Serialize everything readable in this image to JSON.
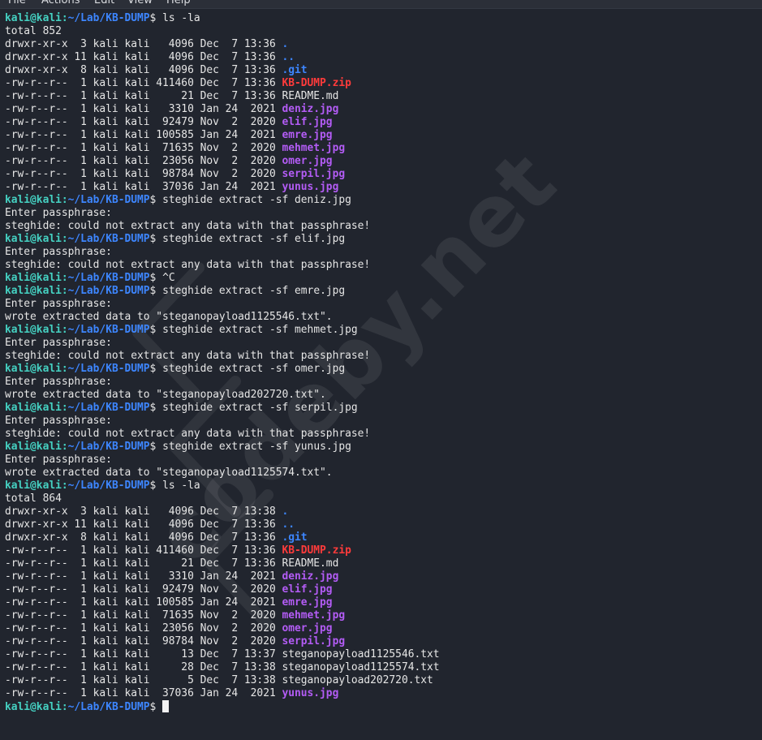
{
  "menu": [
    "File",
    "Actions",
    "Edit",
    "View",
    "Help"
  ],
  "prompt": {
    "user": "kali@kali",
    "path": "~/Lab/KB-DUMP",
    "symbol": "$"
  },
  "watermark": "codeby.net",
  "lines": [
    {
      "type": "prompt",
      "cmd": "ls -la"
    },
    {
      "type": "text",
      "text": "total 852"
    },
    {
      "type": "entry",
      "pre": "drwxr-xr-x  3 kali kali   4096 Dec  7 13:36 ",
      "name": ".",
      "kind": "dir"
    },
    {
      "type": "entry",
      "pre": "drwxr-xr-x 11 kali kali   4096 Dec  7 13:36 ",
      "name": "..",
      "kind": "dir"
    },
    {
      "type": "entry",
      "pre": "drwxr-xr-x  8 kali kali   4096 Dec  7 13:36 ",
      "name": ".git",
      "kind": "dir"
    },
    {
      "type": "entry",
      "pre": "-rw-r--r--  1 kali kali 411460 Dec  7 13:36 ",
      "name": "KB-DUMP.zip",
      "kind": "zip"
    },
    {
      "type": "entry",
      "pre": "-rw-r--r--  1 kali kali     21 Dec  7 13:36 ",
      "name": "README.md",
      "kind": "file"
    },
    {
      "type": "entry",
      "pre": "-rw-r--r--  1 kali kali   3310 Jan 24  2021 ",
      "name": "deniz.jpg",
      "kind": "img"
    },
    {
      "type": "entry",
      "pre": "-rw-r--r--  1 kali kali  92479 Nov  2  2020 ",
      "name": "elif.jpg",
      "kind": "img"
    },
    {
      "type": "entry",
      "pre": "-rw-r--r--  1 kali kali 100585 Jan 24  2021 ",
      "name": "emre.jpg",
      "kind": "img"
    },
    {
      "type": "entry",
      "pre": "-rw-r--r--  1 kali kali  71635 Nov  2  2020 ",
      "name": "mehmet.jpg",
      "kind": "img"
    },
    {
      "type": "entry",
      "pre": "-rw-r--r--  1 kali kali  23056 Nov  2  2020 ",
      "name": "omer.jpg",
      "kind": "img"
    },
    {
      "type": "entry",
      "pre": "-rw-r--r--  1 kali kali  98784 Nov  2  2020 ",
      "name": "serpil.jpg",
      "kind": "img"
    },
    {
      "type": "entry",
      "pre": "-rw-r--r--  1 kali kali  37036 Jan 24  2021 ",
      "name": "yunus.jpg",
      "kind": "img"
    },
    {
      "type": "prompt",
      "cmd": "steghide extract -sf deniz.jpg"
    },
    {
      "type": "text",
      "text": "Enter passphrase:"
    },
    {
      "type": "text",
      "text": "steghide: could not extract any data with that passphrase!"
    },
    {
      "type": "prompt",
      "cmd": "steghide extract -sf elif.jpg"
    },
    {
      "type": "text",
      "text": "Enter passphrase:"
    },
    {
      "type": "text",
      "text": "steghide: could not extract any data with that passphrase!"
    },
    {
      "type": "prompt",
      "cmd": "^C"
    },
    {
      "type": "prompt",
      "cmd": "steghide extract -sf emre.jpg"
    },
    {
      "type": "text",
      "text": "Enter passphrase:"
    },
    {
      "type": "text",
      "text": "wrote extracted data to \"steganopayload1125546.txt\"."
    },
    {
      "type": "prompt",
      "cmd": "steghide extract -sf mehmet.jpg"
    },
    {
      "type": "text",
      "text": "Enter passphrase:"
    },
    {
      "type": "text",
      "text": "steghide: could not extract any data with that passphrase!"
    },
    {
      "type": "prompt",
      "cmd": "steghide extract -sf omer.jpg"
    },
    {
      "type": "text",
      "text": "Enter passphrase:"
    },
    {
      "type": "text",
      "text": "wrote extracted data to \"steganopayload202720.txt\"."
    },
    {
      "type": "prompt",
      "cmd": "steghide extract -sf serpil.jpg"
    },
    {
      "type": "text",
      "text": "Enter passphrase:"
    },
    {
      "type": "text",
      "text": "steghide: could not extract any data with that passphrase!"
    },
    {
      "type": "prompt",
      "cmd": "steghide extract -sf yunus.jpg"
    },
    {
      "type": "text",
      "text": "Enter passphrase:"
    },
    {
      "type": "text",
      "text": "wrote extracted data to \"steganopayload1125574.txt\"."
    },
    {
      "type": "prompt",
      "cmd": "ls -la"
    },
    {
      "type": "text",
      "text": "total 864"
    },
    {
      "type": "entry",
      "pre": "drwxr-xr-x  3 kali kali   4096 Dec  7 13:38 ",
      "name": ".",
      "kind": "dir"
    },
    {
      "type": "entry",
      "pre": "drwxr-xr-x 11 kali kali   4096 Dec  7 13:36 ",
      "name": "..",
      "kind": "dir"
    },
    {
      "type": "entry",
      "pre": "drwxr-xr-x  8 kali kali   4096 Dec  7 13:36 ",
      "name": ".git",
      "kind": "dir"
    },
    {
      "type": "entry",
      "pre": "-rw-r--r--  1 kali kali 411460 Dec  7 13:36 ",
      "name": "KB-DUMP.zip",
      "kind": "zip"
    },
    {
      "type": "entry",
      "pre": "-rw-r--r--  1 kali kali     21 Dec  7 13:36 ",
      "name": "README.md",
      "kind": "file"
    },
    {
      "type": "entry",
      "pre": "-rw-r--r--  1 kali kali   3310 Jan 24  2021 ",
      "name": "deniz.jpg",
      "kind": "img"
    },
    {
      "type": "entry",
      "pre": "-rw-r--r--  1 kali kali  92479 Nov  2  2020 ",
      "name": "elif.jpg",
      "kind": "img"
    },
    {
      "type": "entry",
      "pre": "-rw-r--r--  1 kali kali 100585 Jan 24  2021 ",
      "name": "emre.jpg",
      "kind": "img"
    },
    {
      "type": "entry",
      "pre": "-rw-r--r--  1 kali kali  71635 Nov  2  2020 ",
      "name": "mehmet.jpg",
      "kind": "img"
    },
    {
      "type": "entry",
      "pre": "-rw-r--r--  1 kali kali  23056 Nov  2  2020 ",
      "name": "omer.jpg",
      "kind": "img"
    },
    {
      "type": "entry",
      "pre": "-rw-r--r--  1 kali kali  98784 Nov  2  2020 ",
      "name": "serpil.jpg",
      "kind": "img"
    },
    {
      "type": "entry",
      "pre": "-rw-r--r--  1 kali kali     13 Dec  7 13:37 ",
      "name": "steganopayload1125546.txt",
      "kind": "file"
    },
    {
      "type": "entry",
      "pre": "-rw-r--r--  1 kali kali     28 Dec  7 13:38 ",
      "name": "steganopayload1125574.txt",
      "kind": "file"
    },
    {
      "type": "entry",
      "pre": "-rw-r--r--  1 kali kali      5 Dec  7 13:38 ",
      "name": "steganopayload202720.txt",
      "kind": "file"
    },
    {
      "type": "entry",
      "pre": "-rw-r--r--  1 kali kali  37036 Jan 24  2021 ",
      "name": "yunus.jpg",
      "kind": "img"
    },
    {
      "type": "prompt",
      "cmd": "",
      "cursor": true
    }
  ]
}
